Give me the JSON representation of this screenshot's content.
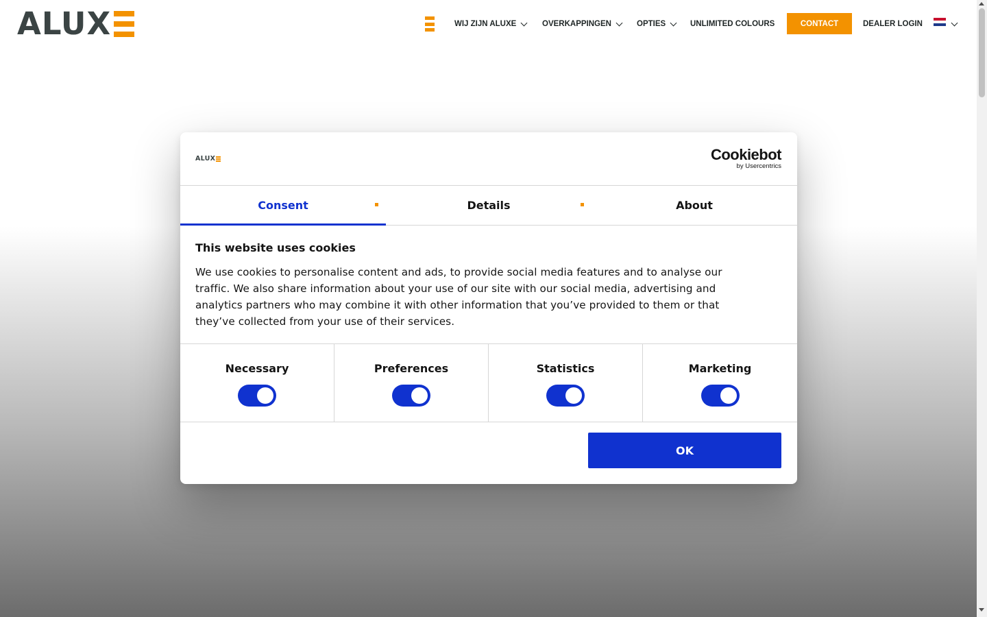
{
  "header": {
    "logo_text": "ALUX",
    "nav_items": [
      {
        "label": "WIJ ZIJN ALUXE"
      },
      {
        "label": "OVERKAPPINGEN"
      },
      {
        "label": "OPTIES"
      },
      {
        "label": "UNLIMITED COLOURS"
      }
    ],
    "contact_label": "CONTACT",
    "dealer_login_label": "DEALER LOGIN",
    "language_flag": "netherlands-flag-icon",
    "accent_color": "#f39200"
  },
  "cookie_dialog": {
    "logo_text": "ALUX",
    "provider_name": "Cookiebot",
    "provider_sub": "by Usercentrics",
    "tabs": [
      {
        "label": "Consent",
        "active": true
      },
      {
        "label": "Details",
        "active": false
      },
      {
        "label": "About",
        "active": false
      }
    ],
    "title": "This website uses cookies",
    "body": "We use cookies to personalise content and ads, to provide social media features and to analyse our traffic. We also share information about your use of our site with our social media, advertising and analytics partners who may combine it with other information that you’ve provided to them or that they’ve collected from your use of their services.",
    "categories": [
      {
        "label": "Necessary",
        "enabled": true
      },
      {
        "label": "Preferences",
        "enabled": true
      },
      {
        "label": "Statistics",
        "enabled": true
      },
      {
        "label": "Marketing",
        "enabled": true
      }
    ],
    "ok_label": "OK",
    "primary_color": "#1032cf"
  }
}
